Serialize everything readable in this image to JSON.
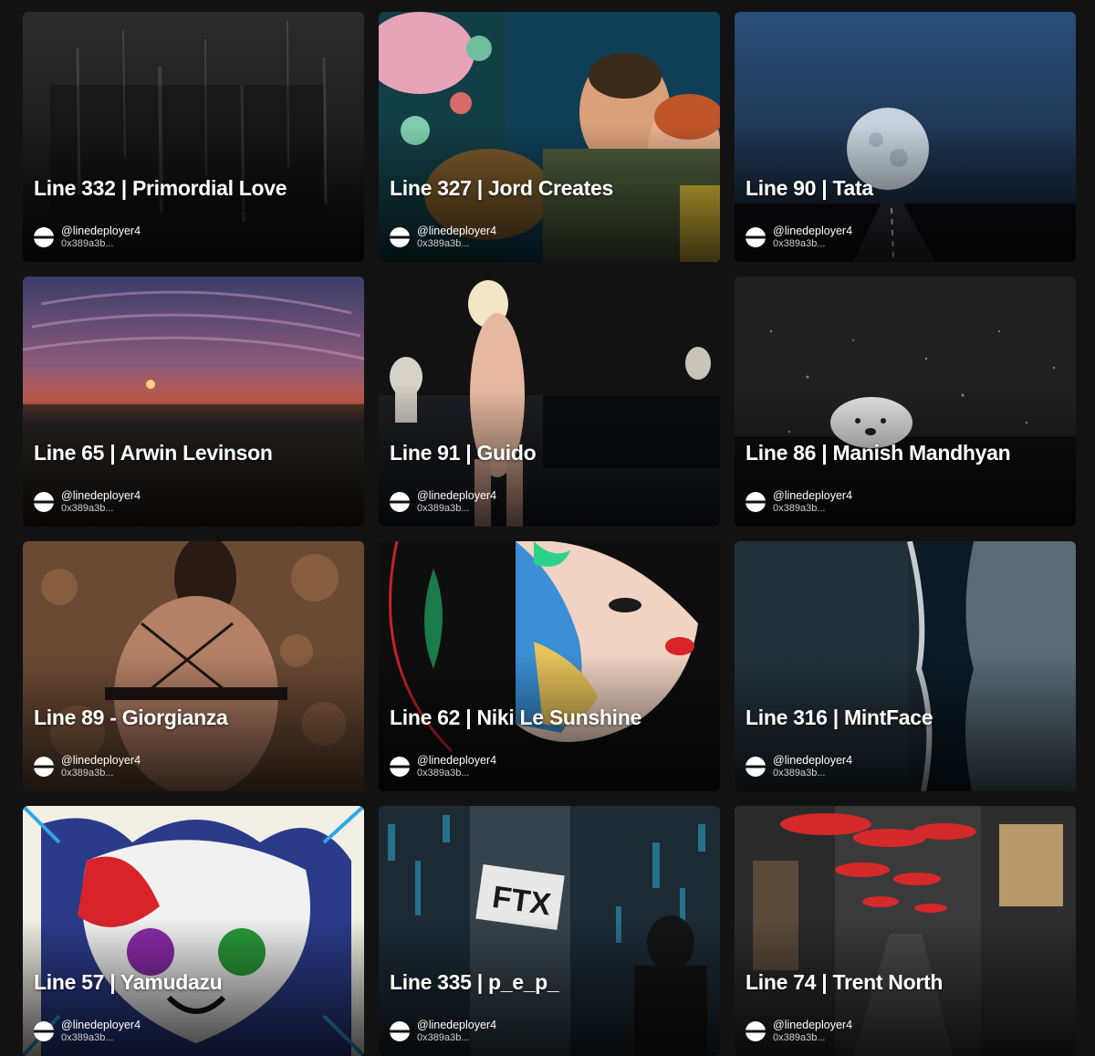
{
  "cards": [
    {
      "title": "Line 332 | Primordial Love",
      "handle": "@linedeployer4",
      "address": "0x389a3b...",
      "art": "dark-texture"
    },
    {
      "title": "Line 327 | Jord Creates",
      "handle": "@linedeployer4",
      "address": "0x389a3b...",
      "art": "retro-couple-collage"
    },
    {
      "title": "Line 90 | Tata",
      "handle": "@linedeployer4",
      "address": "0x389a3b...",
      "art": "moon-over-road"
    },
    {
      "title": "Line 65 | Arwin Levinson",
      "handle": "@linedeployer4",
      "address": "0x389a3b...",
      "art": "canyon-sunset"
    },
    {
      "title": "Line 91 | Guido",
      "handle": "@linedeployer4",
      "address": "0x389a3b...",
      "art": "woman-by-pool"
    },
    {
      "title": "Line 86 | Manish Mandhyan",
      "handle": "@linedeployer4",
      "address": "0x389a3b...",
      "art": "polar-bear-snow"
    },
    {
      "title": "Line 89 - Giorgianza",
      "handle": "@linedeployer4",
      "address": "0x389a3b...",
      "art": "woman-back-portrait"
    },
    {
      "title": "Line 62 | Niki Le Sunshine",
      "handle": "@linedeployer4",
      "address": "0x389a3b...",
      "art": "painted-face-profile"
    },
    {
      "title": "Line 316 | MintFace",
      "handle": "@linedeployer4",
      "address": "0x389a3b...",
      "art": "aerial-coastline"
    },
    {
      "title": "Line 57 | Yamudazu",
      "handle": "@linedeployer4",
      "address": "0x389a3b...",
      "art": "abstract-panda-painting"
    },
    {
      "title": "Line 335 | p_e_p_",
      "handle": "@linedeployer4",
      "address": "0x389a3b...",
      "art": "ftx-graffiti-wall"
    },
    {
      "title": "Line 74 | Trent North",
      "handle": "@linedeployer4",
      "address": "0x389a3b...",
      "art": "street-red-umbrellas"
    }
  ]
}
